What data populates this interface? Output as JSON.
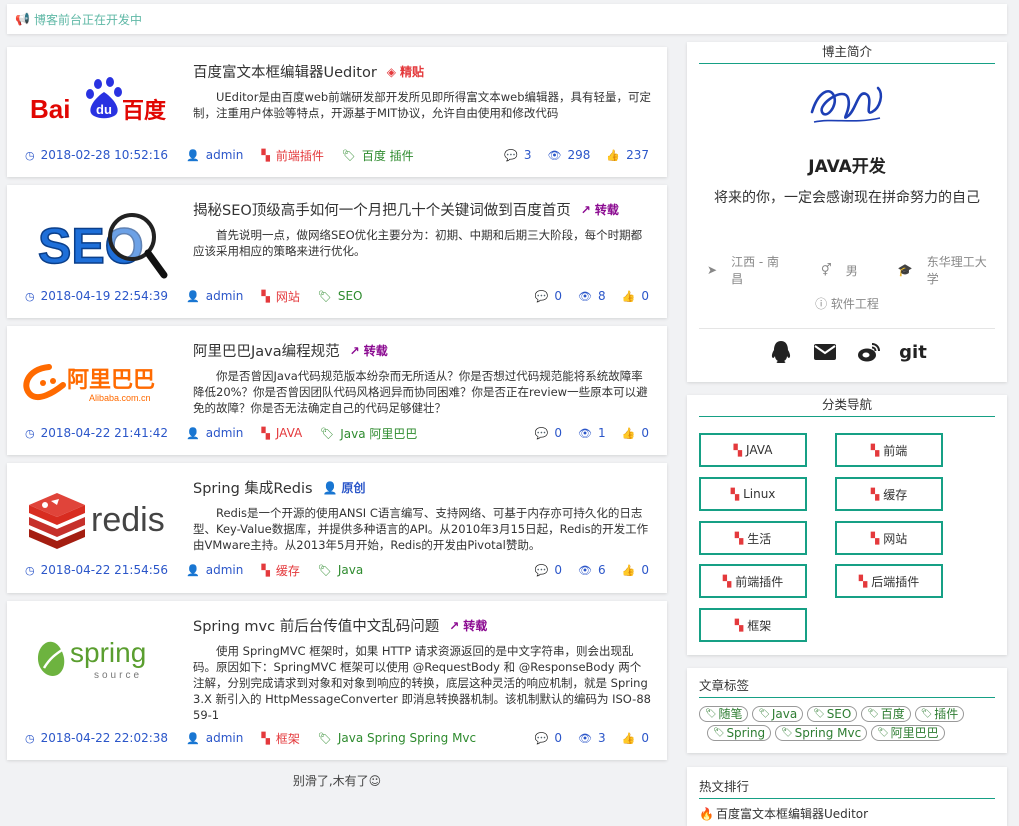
{
  "notice": {
    "text": "博客前台正在开发中",
    "icon": "megaphone-icon"
  },
  "articles": [
    {
      "logo": "baidu-logo",
      "logo_text": "Bai百度",
      "logo_badge": "du",
      "title": "百度富文本框编辑器Ueditor",
      "badge": "精贴",
      "summary": "UEditor是由百度web前端研发部开发所见即所得富文本web编辑器，具有轻量，可定制，注重用户体验等特点，开源基于MIT协议，允许自由使用和修改代码",
      "date": "2018-02-28 10:52:16",
      "author": "admin",
      "category": "前端插件",
      "tags": "百度 插件",
      "comments": "3",
      "views": "298",
      "likes": "237"
    },
    {
      "logo": "seo-image",
      "logo_text": "SEO",
      "title": "揭秘SEO顶级高手如何一个月把几十个关键词做到百度首页",
      "badge": "转载",
      "summary": "首先说明一点，做网络SEO优化主要分为：初期、中期和后期三大阶段，每个时期都应该采用相应的策略来进行优化。",
      "date": "2018-04-19 22:54:39",
      "author": "admin",
      "category": "网站",
      "tags": "SEO",
      "comments": "0",
      "views": "8",
      "likes": "0"
    },
    {
      "logo": "alibaba-logo",
      "logo_text": "阿里巴巴",
      "logo_sub": "Alibaba.com.cn",
      "title": "阿里巴巴Java编程规范",
      "badge": "转载",
      "summary": "你是否曾因Java代码规范版本纷杂而无所适从？你是否想过代码规范能将系统故障率降低20%？你是否曾因团队代码风格迥异而协同困难？你是否正在review一些原本可以避免的故障？你是否无法确定自己的代码足够健壮？",
      "date": "2018-04-22 21:41:42",
      "author": "admin",
      "category": "JAVA",
      "tags": "Java 阿里巴巴",
      "comments": "0",
      "views": "1",
      "likes": "0"
    },
    {
      "logo": "redis-logo",
      "logo_text": "redis",
      "title": "Spring 集成Redis",
      "badge": "原创",
      "summary": "Redis是一个开源的使用ANSI C语言编写、支持网络、可基于内存亦可持久化的日志型、Key-Value数据库，并提供多种语言的API。从2010年3月15日起，Redis的开发工作由VMware主持。从2013年5月开始，Redis的开发由Pivotal赞助。",
      "date": "2018-04-22 21:54:56",
      "author": "admin",
      "category": "缓存",
      "tags": "Java",
      "comments": "0",
      "views": "6",
      "likes": "0"
    },
    {
      "logo": "spring-source-logo",
      "logo_text": "spring",
      "logo_sub": "source",
      "title": "Spring mvc 前后台传值中文乱码问题",
      "badge": "转载",
      "summary": "使用 SpringMVC 框架时，如果 HTTP 请求资源返回的是中文字符串，则会出现乱码。原因如下：SpringMVC 框架可以使用 @RequestBody 和 @ResponseBody 两个注解，分别完成请求到对象和对象到响应的转换，底层这种灵活的响应机制，就是 Spring3.X 新引入的 HttpMessageConverter 即消息转换器机制。该机制默认的编码为 ISO-8859-1",
      "date": "2018-04-22 22:02:38",
      "author": "admin",
      "category": "框架",
      "tags": "Java Spring Spring Mvc",
      "comments": "0",
      "views": "3",
      "likes": "0"
    }
  ],
  "no_more": "别滑了,木有了☺",
  "blogger": {
    "heading": "博主简介",
    "name": "JAVA开发",
    "motto": "将来的你，一定会感谢现在拼命努力的自己",
    "location": "江西 - 南昌",
    "gender": "男",
    "school": "东华理工大学",
    "major": "软件工程",
    "social": [
      "qq-icon",
      "mail-icon",
      "weibo-icon",
      "git"
    ]
  },
  "categories": {
    "heading": "分类导航",
    "items": [
      "JAVA",
      "前端",
      "Linux",
      "缓存",
      "生活",
      "网站",
      "前端插件",
      "后端插件",
      "框架"
    ]
  },
  "tags": {
    "heading": "文章标签",
    "items": [
      "随笔",
      "Java",
      "SEO",
      "百度",
      "插件",
      "Spring",
      "Spring Mvc",
      "阿里巴巴"
    ]
  },
  "hot": {
    "heading": "热文排行",
    "items": [
      "百度富文本框编辑器Ueditor"
    ]
  },
  "colors": {
    "accent": "#16a085",
    "link_blue": "#2b56c9",
    "category_red": "#e4393c",
    "tag_green": "#2e8b2e"
  }
}
